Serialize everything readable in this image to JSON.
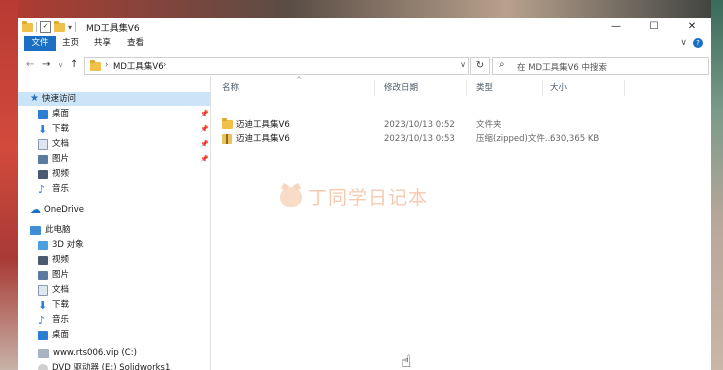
{
  "window": {
    "title": "MD工具集V6",
    "controls": {
      "minimize": "—",
      "maximize": "☐",
      "close": "✕"
    }
  },
  "ribbon": {
    "tabs": [
      "文件",
      "主页",
      "共享",
      "查看"
    ],
    "collapse": "∨",
    "help": "?"
  },
  "address": {
    "back": "←",
    "forward": "→",
    "recent": "∨",
    "up": "↑",
    "chevron": "›",
    "path": "MD工具集V6",
    "path_chevron": "›",
    "dropdown": "∨",
    "refresh": "↻"
  },
  "search": {
    "placeholder": "在 MD工具集V6 中搜索",
    "icon": "search-icon"
  },
  "sidebar": {
    "quick_access": "快速访问",
    "quick_items": [
      {
        "label": "桌面",
        "pinned": true
      },
      {
        "label": "下载",
        "pinned": true
      },
      {
        "label": "文档",
        "pinned": true
      },
      {
        "label": "图片",
        "pinned": true
      },
      {
        "label": "视频",
        "pinned": false
      },
      {
        "label": "音乐",
        "pinned": false
      }
    ],
    "onedrive": "OneDrive",
    "this_pc": "此电脑",
    "pc_items": [
      "3D 对象",
      "视频",
      "图片",
      "文档",
      "下载",
      "音乐",
      "桌面",
      "www.rts006.vip (C:)",
      "DVD 驱动器 (E:) Solidworks1"
    ]
  },
  "columns": {
    "name": "名称",
    "date": "修改日期",
    "type": "类型",
    "size": "大小",
    "sort_indicator": "^"
  },
  "files": [
    {
      "name": "迈迪工具集V6",
      "date": "2023/10/13 0:52",
      "type": "文件夹",
      "size": "",
      "icon": "folder-icon"
    },
    {
      "name": "迈迪工具集V6",
      "date": "2023/10/13 0:53",
      "type": "压缩(zipped)文件...",
      "size": "630,365 KB",
      "icon": "zip-icon"
    }
  ],
  "watermark": {
    "text": "丁同学日记本"
  },
  "colors": {
    "accent": "#1a6fc5",
    "selection": "#cce4f7",
    "folder": "#f1c04a"
  }
}
